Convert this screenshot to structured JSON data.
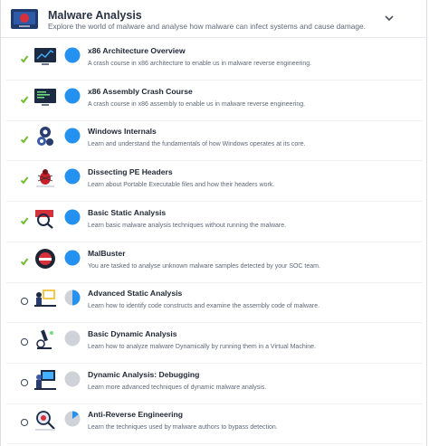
{
  "module": {
    "title": "Malware Analysis",
    "description": "Explore the world of malware and analyse how malware can infect systems and cause damage."
  },
  "colors": {
    "complete_check": "#6fbf2a",
    "progress_blue": "#2490f0",
    "progress_grey": "#cfd3d9"
  },
  "rooms": [
    {
      "title": "x86 Architecture Overview",
      "description": "A crash course in x86 architecture to enable us in malware reverse engineering.",
      "completed": true,
      "progress": 1.0,
      "icon": "monitor-chart-icon"
    },
    {
      "title": "x86 Assembly Crash Course",
      "description": "A crash course in x86 assembly to enable us in malware reverse engineering.",
      "completed": true,
      "progress": 1.0,
      "icon": "monitor-code-icon"
    },
    {
      "title": "Windows Internals",
      "description": "Learn and understand the fundamentals of how Windows operates at its core.",
      "completed": true,
      "progress": 1.0,
      "icon": "gears-icon"
    },
    {
      "title": "Dissecting PE Headers",
      "description": "Learn about Portable Executable files and how their headers work.",
      "completed": true,
      "progress": 1.0,
      "icon": "bug-icon"
    },
    {
      "title": "Basic Static Analysis",
      "description": "Learn basic malware analysis techniques without running the malware.",
      "completed": true,
      "progress": 1.0,
      "icon": "magnifier-icon"
    },
    {
      "title": "MalBuster",
      "description": "You are tasked to analyse unknown malware samples detected by your SOC team.",
      "completed": true,
      "progress": 1.0,
      "icon": "malbuster-icon"
    },
    {
      "title": "Advanced Static Analysis",
      "description": "Learn how to identify code constructs and examine the assembly code of malware.",
      "completed": false,
      "progress": 0.5,
      "icon": "analyst-desk-icon"
    },
    {
      "title": "Basic Dynamic Analysis",
      "description": "Learn how to analyze malware Dynamically by running them in a Virtual Machine.",
      "completed": false,
      "progress": 0.0,
      "icon": "microscope-icon"
    },
    {
      "title": "Dynamic Analysis: Debugging",
      "description": "Learn more advanced techniques of dynamic malware analysis.",
      "completed": false,
      "progress": 0.0,
      "icon": "debugger-desk-icon"
    },
    {
      "title": "Anti-Reverse Engineering",
      "description": "Learn the techniques used by malware authors to bypass detection.",
      "completed": false,
      "progress": 0.15,
      "icon": "anti-re-magnifier-icon"
    }
  ]
}
